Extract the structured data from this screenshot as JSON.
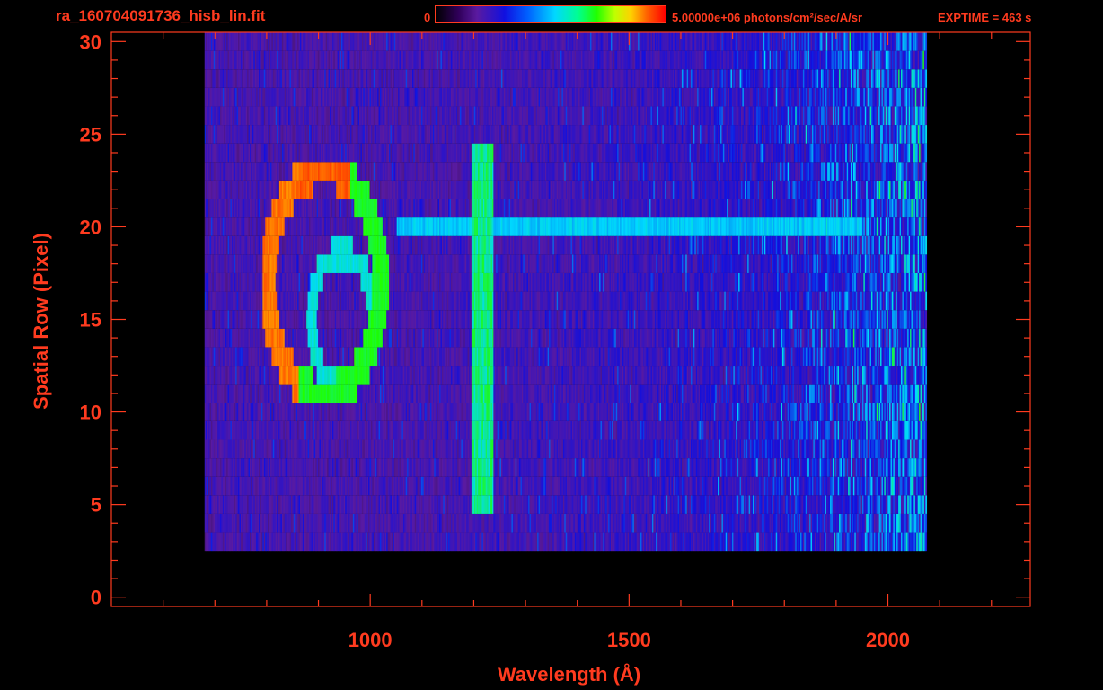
{
  "header": {
    "filename": "ra_160704091736_hisb_lin.fit",
    "colorbar_min": "0",
    "colorbar_max": "5.00000e+06 photons/cm²/sec/A/sr",
    "exptime": "EXPTIME = 463 s"
  },
  "chart_data": {
    "type": "heatmap",
    "title": "ra_160704091736_hisb_lin.fit",
    "xlabel": "Wavelength (Å)",
    "ylabel": "Spatial Row (Pixel)",
    "xlim": [
      500,
      2275
    ],
    "ylim": [
      -0.5,
      30.5
    ],
    "x_ticks": [
      1000,
      1500,
      2000
    ],
    "y_ticks": [
      0,
      5,
      10,
      15,
      20,
      25,
      30
    ],
    "colorscale": {
      "min": 0,
      "max": 5000000,
      "units": "photons/cm²/sec/A/sr",
      "colors": [
        "#000000",
        "#5a1aa0",
        "#1010e0",
        "#00d8ff",
        "#20ff00",
        "#ffd000",
        "#ff0000"
      ]
    },
    "features": [
      {
        "name": "Lyman-alpha line",
        "wavelength": 1216,
        "rows": [
          5,
          24
        ]
      },
      {
        "name": "horizontal spectrum band",
        "row": 20,
        "wavelength_range": [
          1050,
          1950
        ]
      },
      {
        "name": "bright curved emission arc",
        "wavelength_range": [
          790,
          1060
        ],
        "rows": [
          10,
          24
        ]
      }
    ],
    "data_extent": {
      "wavelength_range": [
        680,
        2075
      ],
      "rows": [
        3,
        30
      ]
    }
  }
}
